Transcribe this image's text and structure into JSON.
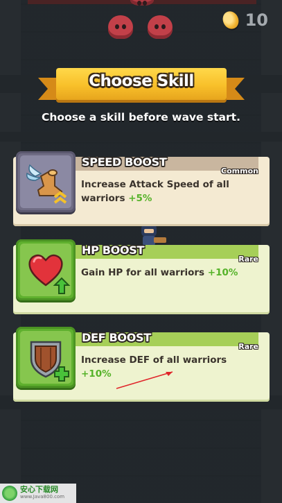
{
  "hud": {
    "coins": "10",
    "coin_icon": "gold-coin-icon"
  },
  "dialog": {
    "title": "Choose Skill",
    "subtitle": "Choose a skill before wave start."
  },
  "skills": [
    {
      "name": "SPEED BOOST",
      "rarity": "Common",
      "description": "Increase Attack Speed of all warriors",
      "bonus": "+5%",
      "icon": "winged-boot-icon"
    },
    {
      "name": "HP BOOST",
      "rarity": "Rare",
      "description": "Gain HP for all warriors",
      "bonus": "+10%",
      "icon": "heart-icon"
    },
    {
      "name": "DEF BOOST",
      "rarity": "Rare",
      "description": "Increase DEF of all warriors",
      "bonus": "+10%",
      "icon": "shield-icon"
    }
  ],
  "watermark": {
    "title": "安心下载网",
    "url": "www.Java800.com"
  },
  "colors": {
    "banner": "#f8c02a",
    "bonus_green": "#55b229",
    "common_panel": "#f4ead2",
    "rare_panel": "#eef3cf",
    "annotation_red": "#e0242a"
  }
}
